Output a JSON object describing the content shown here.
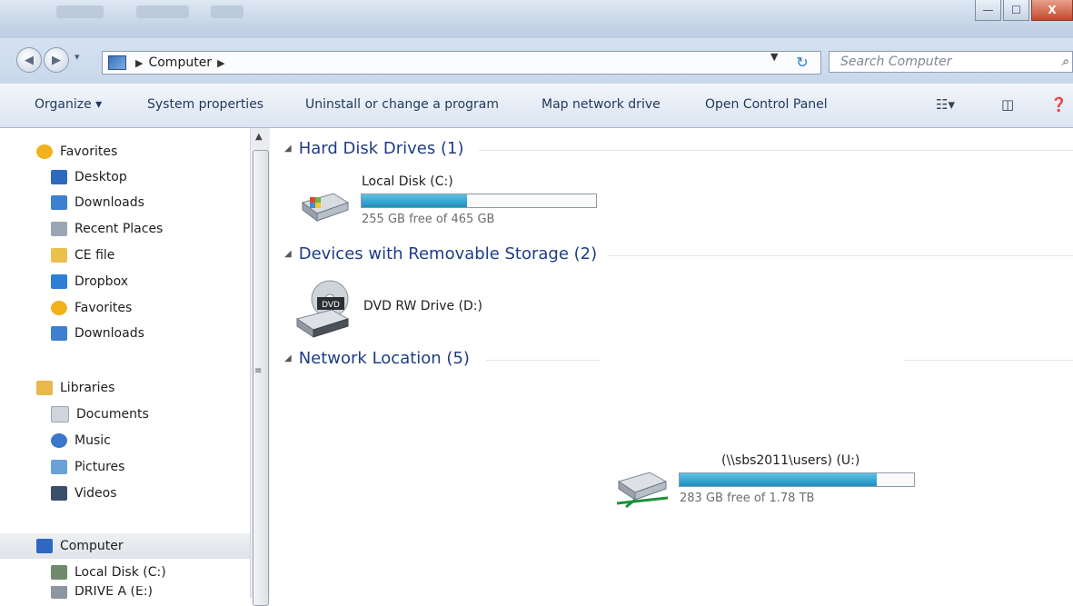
{
  "window": {
    "controls": {
      "minimize": "—",
      "maximize": "☐",
      "close": "X"
    }
  },
  "address": {
    "location": "Computer",
    "search_placeholder": "Search Computer"
  },
  "toolbar": {
    "organize": "Organize ▾",
    "system_properties": "System properties",
    "uninstall": "Uninstall or change a program",
    "map_drive": "Map network drive",
    "open_control_panel": "Open Control Panel"
  },
  "sidebar": {
    "items": [
      {
        "label": "Favorites",
        "icon": "star-icon",
        "color": "#f2b21c"
      },
      {
        "label": "Desktop",
        "icon": "desktop-icon",
        "color": "#2f68c0"
      },
      {
        "label": "Downloads",
        "icon": "downloads-folder-icon",
        "color": "#3d7fd0"
      },
      {
        "label": "Recent Places",
        "icon": "recent-places-icon",
        "color": "#9aa6b3"
      },
      {
        "label": "CE file",
        "icon": "folder-icon",
        "color": "#e9c14b"
      },
      {
        "label": "Dropbox",
        "icon": "dropbox-icon",
        "color": "#2e7ed8"
      },
      {
        "label": "Favorites",
        "icon": "star-icon",
        "color": "#f2b21c"
      },
      {
        "label": "Downloads",
        "icon": "downloads-folder-icon",
        "color": "#3d7fd0"
      },
      {
        "label": "Libraries",
        "icon": "libraries-icon",
        "color": "#e8b94a"
      },
      {
        "label": "Documents",
        "icon": "documents-icon",
        "color": "#cfd6de"
      },
      {
        "label": "Music",
        "icon": "music-icon",
        "color": "#3a76c9"
      },
      {
        "label": "Pictures",
        "icon": "pictures-icon",
        "color": "#6aa2d8"
      },
      {
        "label": "Videos",
        "icon": "videos-icon",
        "color": "#3a4f6b"
      },
      {
        "label": "Computer",
        "icon": "computer-icon",
        "color": "#2f68c0"
      },
      {
        "label": "Local Disk (C:)",
        "icon": "local-disk-icon",
        "color": "#6f8b6b"
      },
      {
        "label": "DRIVE A (E:)",
        "icon": "drive-icon",
        "color": "#8c96a1"
      }
    ]
  },
  "content": {
    "groups": {
      "hard_disks": "Hard Disk Drives (1)",
      "removable": "Devices with Removable Storage (2)",
      "network": "Network Location (5)"
    },
    "local_disk": {
      "name": "Local Disk (C:)",
      "free": "255 GB free of 465 GB",
      "used_fraction": 0.45
    },
    "dvd": {
      "name": "DVD RW Drive (D:)",
      "badge": "DVD"
    },
    "network_drive": {
      "name": "(\\\\sbs2011\\users) (U:)",
      "free": "283 GB free of 1.78 TB",
      "used_fraction": 0.84
    }
  }
}
